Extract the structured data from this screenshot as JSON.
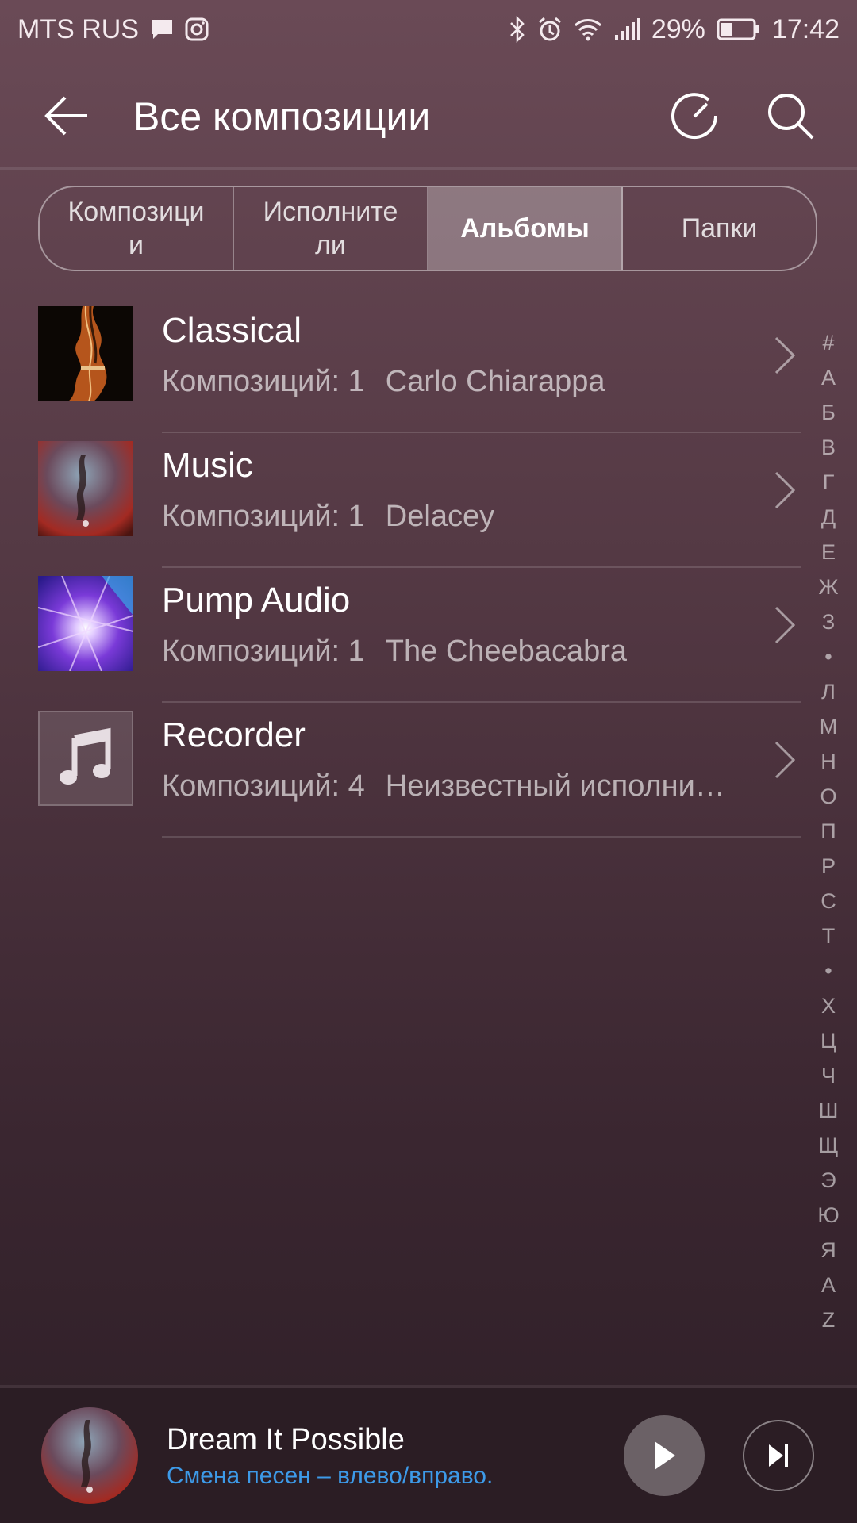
{
  "status_bar": {
    "carrier": "MTS RUS",
    "battery": "29%",
    "time": "17:42",
    "icons": [
      "message-icon",
      "instagram-icon",
      "bluetooth-icon",
      "alarm-icon",
      "wifi-icon",
      "signal-icon",
      "battery-icon"
    ]
  },
  "header": {
    "title": "Все композиции",
    "icons": [
      "back-arrow-icon",
      "refresh-icon",
      "search-icon"
    ]
  },
  "tabs": [
    {
      "label": "Композици\nи",
      "active": false
    },
    {
      "label": "Исполните\nли",
      "active": false
    },
    {
      "label": "Альбомы",
      "active": true
    },
    {
      "label": "Папки",
      "active": false
    }
  ],
  "albums": [
    {
      "title": "Classical",
      "count": "Композиций: 1",
      "artist": "Carlo Chiarappa",
      "art": "violin"
    },
    {
      "title": "Music",
      "count": "Композиций: 1",
      "artist": "Delacey",
      "art": "nebula"
    },
    {
      "title": "Pump Audio",
      "count": "Композиций: 1",
      "artist": "The Cheebacabra",
      "art": "light-burst"
    },
    {
      "title": "Recorder",
      "count": "Композиций: 4",
      "artist": "Неизвестный исполни…",
      "art": "music-note"
    }
  ],
  "alphabet_index": [
    "#",
    "А",
    "Б",
    "В",
    "Г",
    "Д",
    "Е",
    "Ж",
    "З",
    "•",
    "Л",
    "М",
    "Н",
    "О",
    "П",
    "Р",
    "С",
    "Т",
    "•",
    "Х",
    "Ц",
    "Ч",
    "Ш",
    "Щ",
    "Э",
    "Ю",
    "Я",
    "A",
    "Z"
  ],
  "player": {
    "song": "Dream It Possible",
    "hint": "Смена песен – влево/вправо.",
    "hint_color": "#3d9ae8"
  },
  "colors": {
    "background_top": "#6a4a56",
    "background_bottom": "#2e1f27",
    "player_bg": "#2b1d24",
    "accent": "#3d9ae8"
  }
}
